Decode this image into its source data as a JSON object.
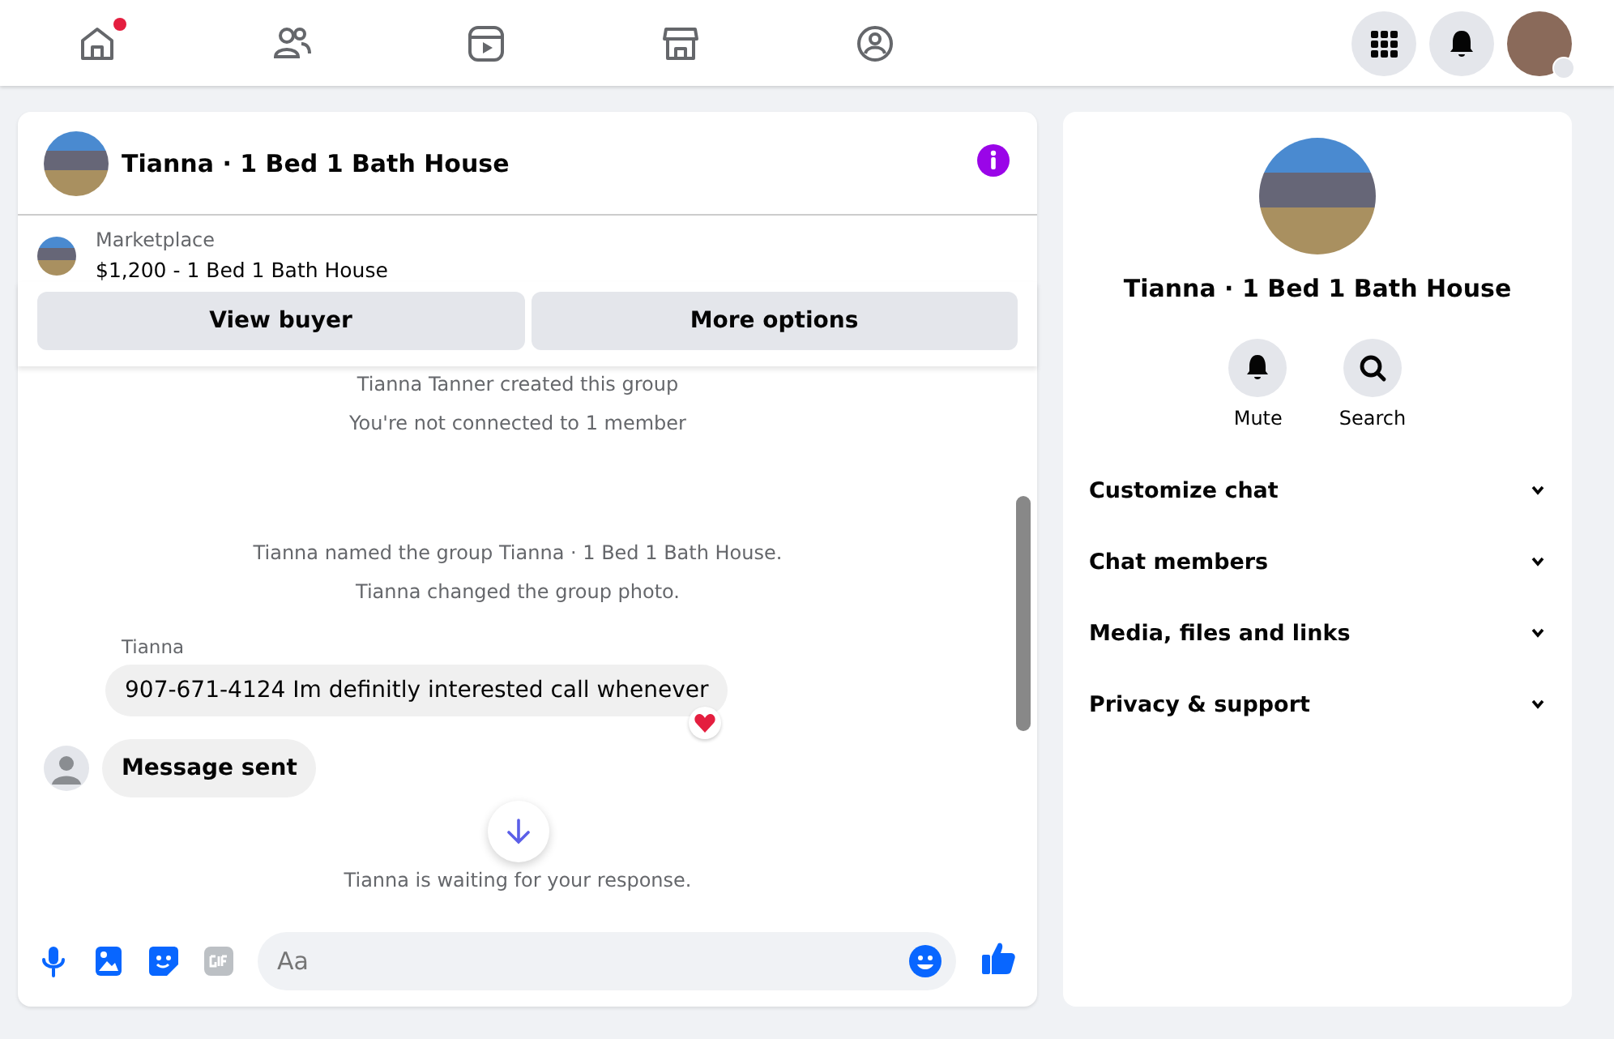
{
  "nav": {
    "items": [
      {
        "kind": "home",
        "selected": false,
        "badge": true
      },
      {
        "kind": "friends",
        "selected": false,
        "badge": false
      },
      {
        "kind": "video",
        "selected": false,
        "badge": false
      },
      {
        "kind": "marketplace",
        "selected": false,
        "badge": false
      },
      {
        "kind": "groups",
        "selected": false,
        "badge": false
      }
    ],
    "actions": [
      {
        "kind": "menu"
      },
      {
        "kind": "notifications"
      },
      {
        "kind": "profile"
      }
    ]
  },
  "chat": {
    "title": "Tianna · 1 Bed 1 Bath House",
    "listing": {
      "source": "Marketplace",
      "summary": "$1,200 - 1 Bed 1 Bath House"
    },
    "buttons": [
      "View buyer",
      "More options"
    ],
    "messages": [
      {
        "kind": "system",
        "text": "Tianna Tanner created this group"
      },
      {
        "kind": "system",
        "text": "You're not connected to 1 member"
      },
      {
        "kind": "gap"
      },
      {
        "kind": "system",
        "text": "Tianna named the group Tianna · 1 Bed 1 Bath House."
      },
      {
        "kind": "system",
        "text": "Tianna changed the group photo."
      },
      {
        "kind": "incoming",
        "sender": "Tianna",
        "text": "907-671-4124 Im definitly interested call whenever",
        "reacted": true
      },
      {
        "kind": "notice",
        "text": "Message sent",
        "reacted": false
      },
      {
        "kind": "system",
        "text": "Tianna is waiting for your response."
      }
    ],
    "composer": {
      "placeholder": "Aa",
      "tools": [
        {
          "kind": "mic"
        },
        {
          "kind": "photo"
        },
        {
          "kind": "sticker"
        },
        {
          "kind": "gif"
        }
      ]
    }
  },
  "details": {
    "title": "Tianna · 1 Bed 1 Bath House",
    "actions": [
      {
        "kind": "mute",
        "label": "Mute"
      },
      {
        "kind": "search",
        "label": "Search"
      }
    ],
    "sections": [
      {
        "label": "Customize chat",
        "expanded": false
      },
      {
        "label": "Chat members",
        "expanded": false
      },
      {
        "label": "Media, files and links",
        "expanded": false
      },
      {
        "label": "Privacy & support",
        "expanded": false
      }
    ]
  }
}
